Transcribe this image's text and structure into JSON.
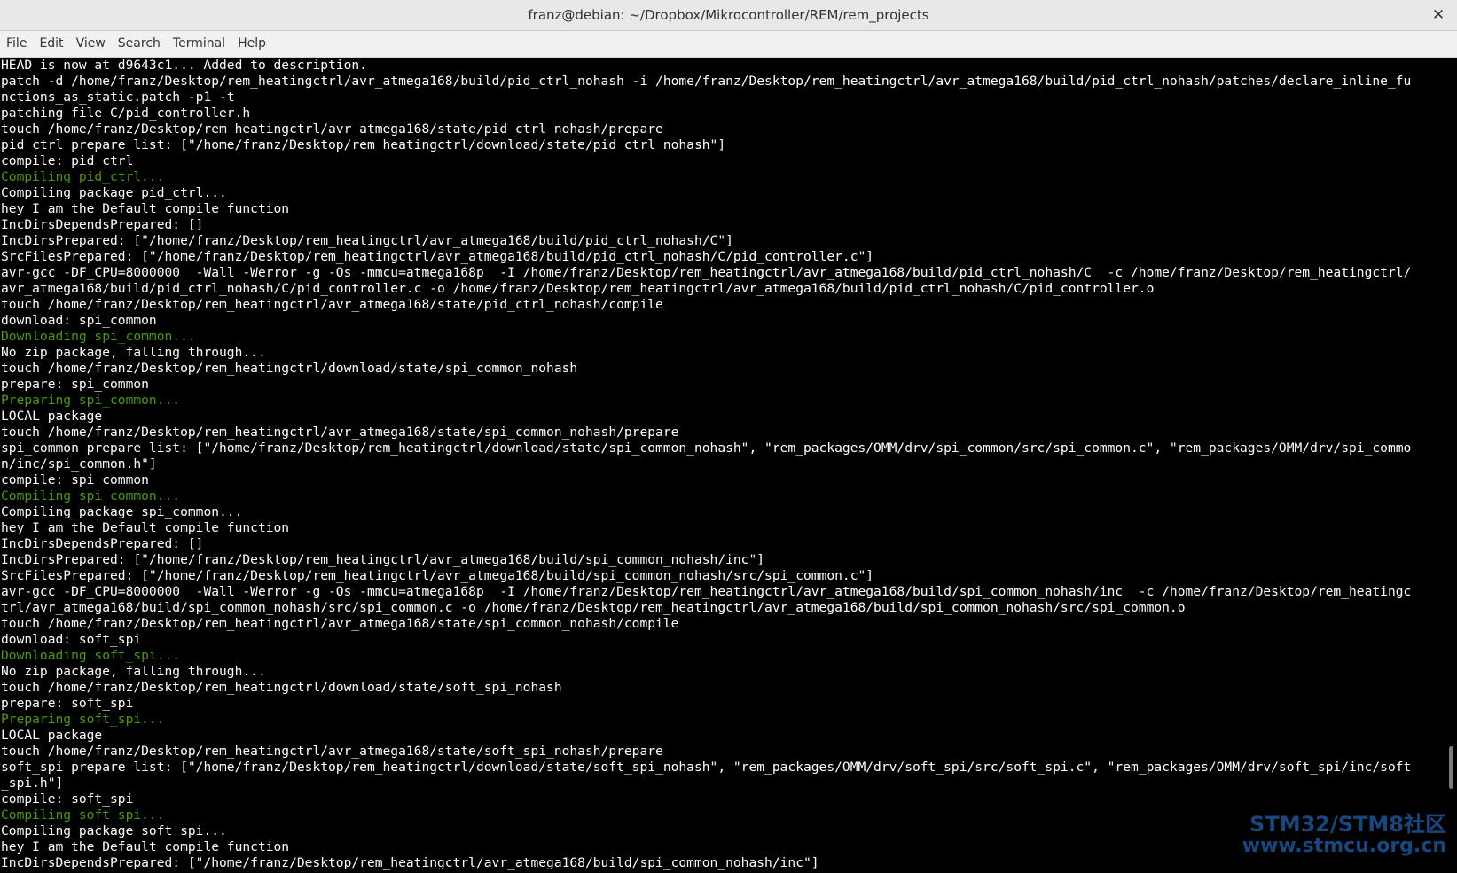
{
  "window": {
    "title": "franz@debian: ~/Dropbox/Mikrocontroller/REM/rem_projects",
    "close_glyph": "✕"
  },
  "menu": [
    "File",
    "Edit",
    "View",
    "Search",
    "Terminal",
    "Help"
  ],
  "colors": {
    "terminal_bg": "#000000",
    "terminal_fg": "#ffffff",
    "status_green": "#4e9a06",
    "watermark_blue": "#1f5fa8"
  },
  "terminal_lines": [
    {
      "text": "HEAD is now at d9643c1... Added to description.",
      "style": "normal"
    },
    {
      "text": "patch -d /home/franz/Desktop/rem_heatingctrl/avr_atmega168/build/pid_ctrl_nohash -i /home/franz/Desktop/rem_heatingctrl/avr_atmega168/build/pid_ctrl_nohash/patches/declare_inline_fu",
      "style": "normal"
    },
    {
      "text": "nctions_as_static.patch -p1 -t",
      "style": "normal"
    },
    {
      "text": "patching file C/pid_controller.h",
      "style": "normal"
    },
    {
      "text": "touch /home/franz/Desktop/rem_heatingctrl/avr_atmega168/state/pid_ctrl_nohash/prepare",
      "style": "normal"
    },
    {
      "text": "pid_ctrl prepare list: [\"/home/franz/Desktop/rem_heatingctrl/download/state/pid_ctrl_nohash\"]",
      "style": "normal"
    },
    {
      "text": "compile: pid_ctrl",
      "style": "normal"
    },
    {
      "text": "Compiling pid_ctrl...",
      "style": "green"
    },
    {
      "text": "Compiling package pid_ctrl...",
      "style": "normal"
    },
    {
      "text": "hey I am the Default compile function",
      "style": "normal"
    },
    {
      "text": "IncDirsDependsPrepared: []",
      "style": "normal"
    },
    {
      "text": "IncDirsPrepared: [\"/home/franz/Desktop/rem_heatingctrl/avr_atmega168/build/pid_ctrl_nohash/C\"]",
      "style": "normal"
    },
    {
      "text": "SrcFilesPrepared: [\"/home/franz/Desktop/rem_heatingctrl/avr_atmega168/build/pid_ctrl_nohash/C/pid_controller.c\"]",
      "style": "normal"
    },
    {
      "text": "avr-gcc -DF_CPU=8000000  -Wall -Werror -g -Os -mmcu=atmega168p  -I /home/franz/Desktop/rem_heatingctrl/avr_atmega168/build/pid_ctrl_nohash/C  -c /home/franz/Desktop/rem_heatingctrl/",
      "style": "normal"
    },
    {
      "text": "avr_atmega168/build/pid_ctrl_nohash/C/pid_controller.c -o /home/franz/Desktop/rem_heatingctrl/avr_atmega168/build/pid_ctrl_nohash/C/pid_controller.o",
      "style": "normal"
    },
    {
      "text": "touch /home/franz/Desktop/rem_heatingctrl/avr_atmega168/state/pid_ctrl_nohash/compile",
      "style": "normal"
    },
    {
      "text": "download: spi_common",
      "style": "normal"
    },
    {
      "text": "Downloading spi_common...",
      "style": "green"
    },
    {
      "text": "No zip package, falling through...",
      "style": "normal"
    },
    {
      "text": "touch /home/franz/Desktop/rem_heatingctrl/download/state/spi_common_nohash",
      "style": "normal"
    },
    {
      "text": "prepare: spi_common",
      "style": "normal"
    },
    {
      "text": "Preparing spi_common...",
      "style": "green"
    },
    {
      "text": "LOCAL package",
      "style": "normal"
    },
    {
      "text": "touch /home/franz/Desktop/rem_heatingctrl/avr_atmega168/state/spi_common_nohash/prepare",
      "style": "normal"
    },
    {
      "text": "spi_common prepare list: [\"/home/franz/Desktop/rem_heatingctrl/download/state/spi_common_nohash\", \"rem_packages/OMM/drv/spi_common/src/spi_common.c\", \"rem_packages/OMM/drv/spi_commo",
      "style": "normal"
    },
    {
      "text": "n/inc/spi_common.h\"]",
      "style": "normal"
    },
    {
      "text": "compile: spi_common",
      "style": "normal"
    },
    {
      "text": "Compiling spi_common...",
      "style": "green"
    },
    {
      "text": "Compiling package spi_common...",
      "style": "normal"
    },
    {
      "text": "hey I am the Default compile function",
      "style": "normal"
    },
    {
      "text": "IncDirsDependsPrepared: []",
      "style": "normal"
    },
    {
      "text": "IncDirsPrepared: [\"/home/franz/Desktop/rem_heatingctrl/avr_atmega168/build/spi_common_nohash/inc\"]",
      "style": "normal"
    },
    {
      "text": "SrcFilesPrepared: [\"/home/franz/Desktop/rem_heatingctrl/avr_atmega168/build/spi_common_nohash/src/spi_common.c\"]",
      "style": "normal"
    },
    {
      "text": "avr-gcc -DF_CPU=8000000  -Wall -Werror -g -Os -mmcu=atmega168p  -I /home/franz/Desktop/rem_heatingctrl/avr_atmega168/build/spi_common_nohash/inc  -c /home/franz/Desktop/rem_heatingc",
      "style": "normal"
    },
    {
      "text": "trl/avr_atmega168/build/spi_common_nohash/src/spi_common.c -o /home/franz/Desktop/rem_heatingctrl/avr_atmega168/build/spi_common_nohash/src/spi_common.o",
      "style": "normal"
    },
    {
      "text": "touch /home/franz/Desktop/rem_heatingctrl/avr_atmega168/state/spi_common_nohash/compile",
      "style": "normal"
    },
    {
      "text": "download: soft_spi",
      "style": "normal"
    },
    {
      "text": "Downloading soft_spi...",
      "style": "green"
    },
    {
      "text": "No zip package, falling through...",
      "style": "normal"
    },
    {
      "text": "touch /home/franz/Desktop/rem_heatingctrl/download/state/soft_spi_nohash",
      "style": "normal"
    },
    {
      "text": "prepare: soft_spi",
      "style": "normal"
    },
    {
      "text": "Preparing soft_spi...",
      "style": "green"
    },
    {
      "text": "LOCAL package",
      "style": "normal"
    },
    {
      "text": "touch /home/franz/Desktop/rem_heatingctrl/avr_atmega168/state/soft_spi_nohash/prepare",
      "style": "normal"
    },
    {
      "text": "soft_spi prepare list: [\"/home/franz/Desktop/rem_heatingctrl/download/state/soft_spi_nohash\", \"rem_packages/OMM/drv/soft_spi/src/soft_spi.c\", \"rem_packages/OMM/drv/soft_spi/inc/soft",
      "style": "normal"
    },
    {
      "text": "_spi.h\"]",
      "style": "normal"
    },
    {
      "text": "compile: soft_spi",
      "style": "normal"
    },
    {
      "text": "Compiling soft_spi...",
      "style": "green"
    },
    {
      "text": "Compiling package soft_spi...",
      "style": "normal"
    },
    {
      "text": "hey I am the Default compile function",
      "style": "normal"
    },
    {
      "text": "IncDirsDependsPrepared: [\"/home/franz/Desktop/rem_heatingctrl/avr_atmega168/build/spi_common_nohash/inc\"]",
      "style": "normal"
    }
  ],
  "watermark": {
    "line1": "STM32/STM8社区",
    "line2": "www.stmcu.org.cn"
  }
}
